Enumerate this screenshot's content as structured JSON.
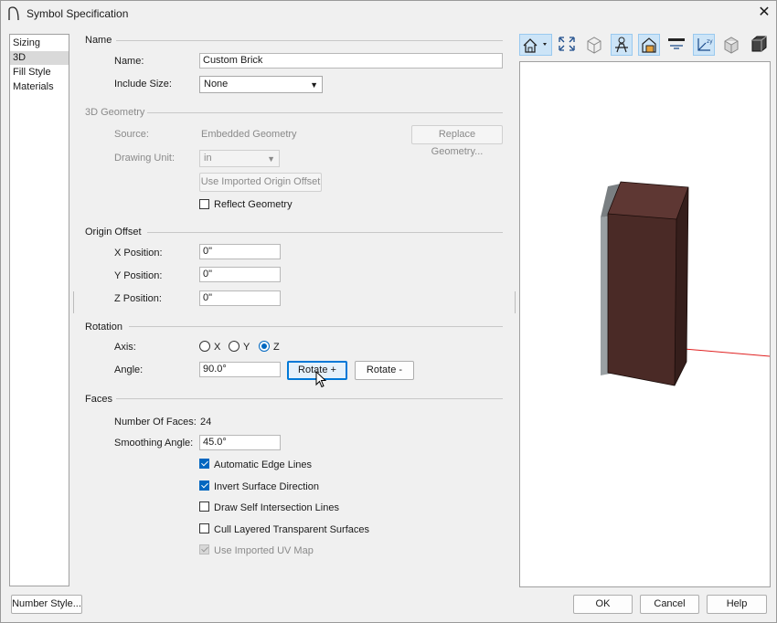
{
  "window": {
    "title": "Symbol Specification",
    "close_glyph": "✕"
  },
  "sidebar": {
    "items": [
      {
        "label": "Sizing"
      },
      {
        "label": "3D"
      },
      {
        "label": "Fill Style"
      },
      {
        "label": "Materials"
      }
    ]
  },
  "name_section": {
    "header": "Name",
    "name_label": "Name:",
    "name_value": "Custom Brick",
    "include_size_label": "Include Size:",
    "include_size_value": "None"
  },
  "geometry_section": {
    "header": "3D Geometry",
    "source_label": "Source:",
    "source_value": "Embedded Geometry",
    "replace_button": "Replace Geometry...",
    "drawing_unit_label": "Drawing Unit:",
    "drawing_unit_value": "in",
    "use_imported_origin_button": "Use Imported Origin Offset",
    "reflect_label": "Reflect Geometry",
    "reflect_checked": false
  },
  "origin_section": {
    "header": "Origin Offset",
    "x_label": "X Position:",
    "x_value": "0\"",
    "y_label": "Y Position:",
    "y_value": "0\"",
    "z_label": "Z Position:",
    "z_value": "0\""
  },
  "rotation_section": {
    "header": "Rotation",
    "axis_label": "Axis:",
    "axis_x": "X",
    "axis_y": "Y",
    "axis_z": "Z",
    "axis_selected": "Z",
    "angle_label": "Angle:",
    "angle_value": "90.0°",
    "rotate_plus": "Rotate +",
    "rotate_minus": "Rotate -"
  },
  "faces_section": {
    "header": "Faces",
    "num_faces_label": "Number Of Faces:",
    "num_faces_value": "24",
    "smoothing_label": "Smoothing Angle:",
    "smoothing_value": "45.0°",
    "checkboxes": [
      {
        "label": "Automatic Edge Lines",
        "checked": true,
        "enabled": true
      },
      {
        "label": "Invert Surface Direction",
        "checked": true,
        "enabled": true
      },
      {
        "label": "Draw Self Intersection Lines",
        "checked": false,
        "enabled": true
      },
      {
        "label": "Cull Layered Transparent Surfaces",
        "checked": false,
        "enabled": true
      },
      {
        "label": "Use Imported UV Map",
        "checked": true,
        "enabled": false
      }
    ]
  },
  "preview_toolbar": {
    "icons": [
      "view-type-icon",
      "fill-window-icon",
      "wireframe-icon",
      "camera-orbit-icon",
      "material-icon",
      "section-icon",
      "axes-icon",
      "glass-icon",
      "shaded-icon"
    ]
  },
  "colors": {
    "brick_front": "#4a2a26",
    "brick_top": "#5e3733",
    "brick_side": "#351e1b",
    "grey_panel": "#9aa0a3",
    "axis_line": "#e02020",
    "accent": "#0067c0"
  },
  "footer": {
    "number_style": "Number Style...",
    "ok": "OK",
    "cancel": "Cancel",
    "help": "Help"
  }
}
